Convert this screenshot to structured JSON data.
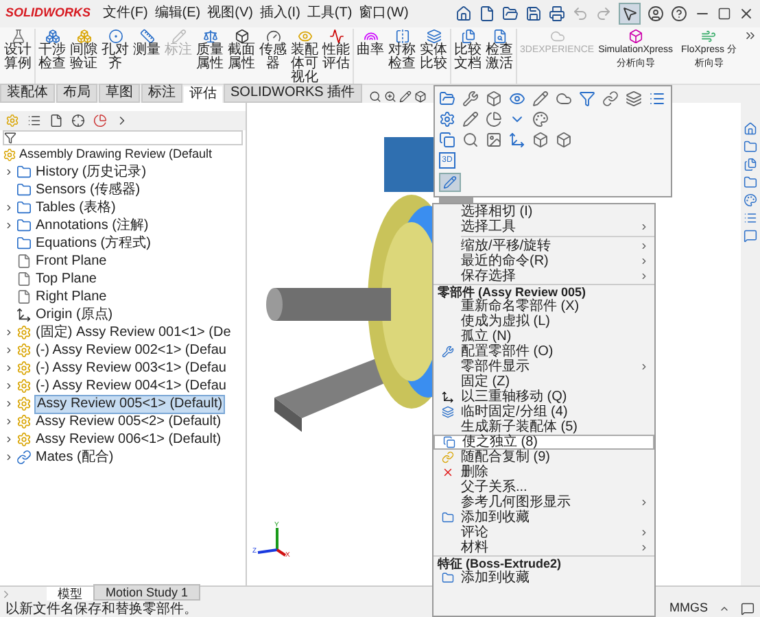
{
  "app": {
    "logo": "SOLIDWORKS"
  },
  "menu_bar": [
    "文件(F)",
    "编辑(E)",
    "视图(V)",
    "插入(I)",
    "工具(T)",
    "窗口(W)"
  ],
  "ribbon": [
    {
      "label": "设计算例",
      "kind": "cjk",
      "disabled": false,
      "group_start": false
    },
    {
      "label": "干涉检查",
      "kind": "cjk",
      "disabled": false,
      "group_start": true
    },
    {
      "label": "间隙验证",
      "kind": "cjk",
      "disabled": false,
      "group_start": false
    },
    {
      "label": "孔对齐",
      "kind": "cjk",
      "disabled": false,
      "group_start": false
    },
    {
      "label": "测量",
      "kind": "cjk",
      "disabled": false,
      "group_start": false
    },
    {
      "label": "标注",
      "kind": "cjk",
      "disabled": true,
      "group_start": false
    },
    {
      "label": "质量属性",
      "kind": "cjk",
      "disabled": false,
      "group_start": false
    },
    {
      "label": "截面属性",
      "kind": "cjk",
      "disabled": false,
      "group_start": false
    },
    {
      "label": "传感器",
      "kind": "cjk",
      "disabled": false,
      "group_start": false
    },
    {
      "label": "装配体可视化",
      "kind": "cjk",
      "disabled": false,
      "group_start": false
    },
    {
      "label": "性能评估",
      "kind": "cjk",
      "disabled": false,
      "group_start": false
    },
    {
      "label": "曲率",
      "kind": "cjk",
      "disabled": false,
      "group_start": true
    },
    {
      "label": "对称检查",
      "kind": "cjk",
      "disabled": false,
      "group_start": false
    },
    {
      "label": "实体比较",
      "kind": "cjk",
      "disabled": false,
      "group_start": false
    },
    {
      "label": "比较文档",
      "kind": "cjk",
      "disabled": false,
      "group_start": true
    },
    {
      "label": "检查激活",
      "kind": "cjk",
      "disabled": false,
      "group_start": false
    },
    {
      "label": "3DEXPERIENCE",
      "kind": "latin",
      "disabled": true,
      "group_start": true
    },
    {
      "label": "SimulationXpress 分析向导",
      "kind": "latin",
      "disabled": false,
      "group_start": false
    },
    {
      "label": "FloXpress 分析向导",
      "kind": "latin",
      "disabled": false,
      "group_start": false
    }
  ],
  "tabs": [
    {
      "label": "装配体",
      "selected": false
    },
    {
      "label": "布局",
      "selected": false
    },
    {
      "label": "草图",
      "selected": false
    },
    {
      "label": "标注",
      "selected": false
    },
    {
      "label": "评估",
      "selected": true
    },
    {
      "label": "SOLIDWORKS 插件",
      "selected": false
    }
  ],
  "tree": {
    "root": {
      "label": "Assembly Drawing Review (Default",
      "children": [
        {
          "label": "History (历史记录)",
          "expandable": true,
          "selected": false
        },
        {
          "label": "Sensors (传感器)",
          "expandable": false,
          "selected": false
        },
        {
          "label": "Tables (表格)",
          "expandable": true,
          "selected": false
        },
        {
          "label": "Annotations (注解)",
          "expandable": true,
          "selected": false
        },
        {
          "label": "Equations (方程式)",
          "expandable": false,
          "selected": false
        },
        {
          "label": "Front Plane",
          "expandable": false,
          "selected": false
        },
        {
          "label": "Top Plane",
          "expandable": false,
          "selected": false
        },
        {
          "label": "Right Plane",
          "expandable": false,
          "selected": false
        },
        {
          "label": "Origin (原点)",
          "expandable": false,
          "selected": false
        },
        {
          "label": "(固定) Assy Review 001<1> (De",
          "expandable": true,
          "selected": false
        },
        {
          "label": "(-) Assy Review 002<1> (Defau",
          "expandable": true,
          "selected": false
        },
        {
          "label": "(-) Assy Review 003<1> (Defau",
          "expandable": true,
          "selected": false
        },
        {
          "label": "(-) Assy Review 004<1> (Defau",
          "expandable": true,
          "selected": false
        },
        {
          "label": "Assy Review 005<1> (Default)",
          "expandable": true,
          "selected": true
        },
        {
          "label": "Assy Review 005<2> (Default)",
          "expandable": true,
          "selected": false
        },
        {
          "label": "Assy Review 006<1> (Default)",
          "expandable": true,
          "selected": false
        },
        {
          "label": "Mates (配合)",
          "expandable": true,
          "selected": false
        }
      ]
    }
  },
  "popup_toolbar": {
    "label_3d": "3D"
  },
  "context_menu": [
    {
      "kind": "item",
      "label": "选择相切 (I)",
      "submenu": false,
      "selected": false
    },
    {
      "kind": "item",
      "label": "选择工具",
      "submenu": true,
      "selected": false
    },
    {
      "kind": "divider"
    },
    {
      "kind": "item",
      "label": "缩放/平移/旋转",
      "submenu": true,
      "selected": false
    },
    {
      "kind": "item",
      "label": "最近的命令(R)",
      "submenu": true,
      "selected": false
    },
    {
      "kind": "item",
      "label": "保存选择",
      "submenu": true,
      "selected": false
    },
    {
      "kind": "header",
      "label": "零部件 (Assy Review 005)"
    },
    {
      "kind": "item",
      "label": "重新命名零部件 (X)",
      "submenu": false,
      "selected": false
    },
    {
      "kind": "item",
      "label": "使成为虚拟 (L)",
      "submenu": false,
      "selected": false
    },
    {
      "kind": "item",
      "label": "孤立 (N)",
      "submenu": false,
      "selected": false
    },
    {
      "kind": "item",
      "label": "配置零部件 (O)",
      "submenu": false,
      "selected": false
    },
    {
      "kind": "item",
      "label": "零部件显示",
      "submenu": true,
      "selected": false
    },
    {
      "kind": "item",
      "label": "固定 (Z)",
      "submenu": false,
      "selected": false
    },
    {
      "kind": "item",
      "label": "以三重轴移动 (Q)",
      "submenu": false,
      "selected": false
    },
    {
      "kind": "item",
      "label": "临时固定/分组 (4)",
      "submenu": false,
      "selected": false
    },
    {
      "kind": "item",
      "label": "生成新子装配体 (5)",
      "submenu": false,
      "selected": false
    },
    {
      "kind": "item",
      "label": "使之独立 (8)",
      "submenu": false,
      "selected": true
    },
    {
      "kind": "item",
      "label": "随配合复制 (9)",
      "submenu": false,
      "selected": false
    },
    {
      "kind": "item",
      "label": "删除",
      "submenu": false,
      "selected": false
    },
    {
      "kind": "item",
      "label": "父子关系...",
      "submenu": false,
      "selected": false
    },
    {
      "kind": "item",
      "label": "参考几何图形显示",
      "submenu": true,
      "selected": false
    },
    {
      "kind": "item",
      "label": "添加到收藏",
      "submenu": false,
      "selected": false
    },
    {
      "kind": "item",
      "label": "评论",
      "submenu": true,
      "selected": false
    },
    {
      "kind": "item",
      "label": "材料",
      "submenu": true,
      "selected": false
    },
    {
      "kind": "header",
      "label": "特征 (Boss-Extrude2)"
    },
    {
      "kind": "item",
      "label": "添加到收藏",
      "submenu": false,
      "selected": false
    }
  ],
  "triad_labels": [
    "Y",
    "Z",
    "X"
  ],
  "bottom_tabs": [
    {
      "label": "模型",
      "selected": true
    },
    {
      "label": "Motion Study 1",
      "selected": false
    }
  ],
  "status_bar": {
    "message": "以新文件名保存和替换零部件。",
    "units": "MMGS"
  }
}
